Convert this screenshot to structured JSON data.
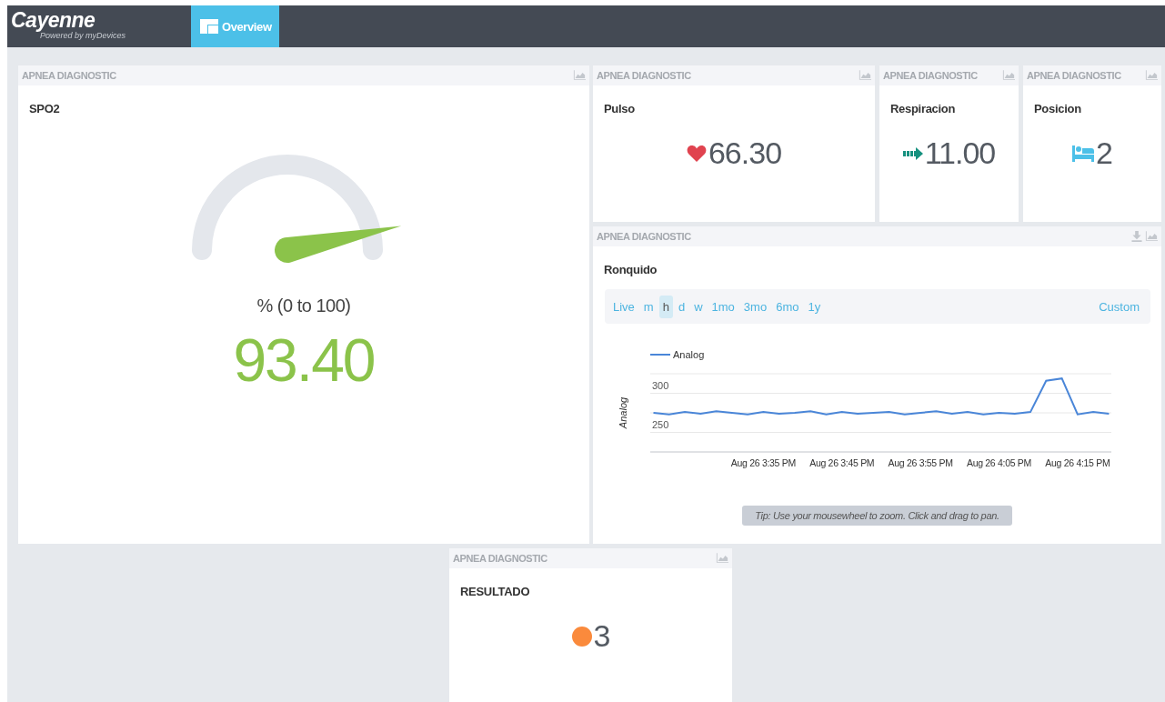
{
  "header": {
    "logo": "Cayenne",
    "tagline": "Powered by myDevices",
    "tabs": [
      {
        "label": "Overview",
        "selected": true
      }
    ]
  },
  "widgets": [
    {
      "kind": "gauge",
      "header": "APNEA DIAGNOSTIC",
      "title": "SPO2",
      "unit": "% (0 to 100)",
      "value": "93.40"
    },
    {
      "kind": "heart-value",
      "header": "APNEA DIAGNOSTIC",
      "title": "Pulso",
      "value": "66.30"
    },
    {
      "kind": "arrow-value",
      "header": "APNEA DIAGNOSTIC",
      "title": "Respiracion",
      "value": "11.00"
    },
    {
      "kind": "bed-value",
      "header": "APNEA DIAGNOSTIC",
      "title": "Posicion",
      "value": "2"
    },
    {
      "kind": "chart",
      "header": "APNEA DIAGNOSTIC",
      "title": "Ronquido",
      "ranges": [
        {
          "label": "Live",
          "selected": false
        },
        {
          "label": "m",
          "selected": false
        },
        {
          "label": "h",
          "selected": true
        },
        {
          "label": "d",
          "selected": false
        },
        {
          "label": "w",
          "selected": false
        },
        {
          "label": "1mo",
          "selected": false
        },
        {
          "label": "3mo",
          "selected": false
        },
        {
          "label": "6mo",
          "selected": false
        },
        {
          "label": "1y",
          "selected": false
        }
      ],
      "custom": "Custom",
      "tip": "Tip: Use your mousewheel to zoom. Click and drag to pan.",
      "chart_data": {
        "type": "line",
        "ylabel": "Analog",
        "categories": [
          null,
          null,
          null,
          null,
          null,
          null,
          null,
          "Aug 26 3:35 PM",
          null,
          null,
          null,
          null,
          "Aug 26 3:45 PM",
          null,
          null,
          null,
          null,
          "Aug 26 3:55 PM",
          null,
          null,
          null,
          null,
          "Aug 26 4:05 PM",
          null,
          null,
          null,
          null,
          "Aug 26 4:15 PM",
          null,
          null
        ],
        "series": [
          {
            "name": "Analog",
            "color": "#4a86d8",
            "values": [
              275,
              273,
              276,
              274,
              277,
              275,
              273,
              276,
              274,
              275,
              277,
              273,
              276,
              274,
              275,
              276,
              273,
              275,
              277,
              274,
              276,
              273,
              275,
              274,
              276,
              316,
              319,
              273,
              276,
              274
            ]
          }
        ],
        "ylim": [
          225,
          325
        ],
        "yticks": [
          250,
          300
        ]
      }
    },
    {
      "kind": "dot-value",
      "header": "APNEA DIAGNOSTIC",
      "title": "RESULTADO",
      "value": "3"
    }
  ]
}
